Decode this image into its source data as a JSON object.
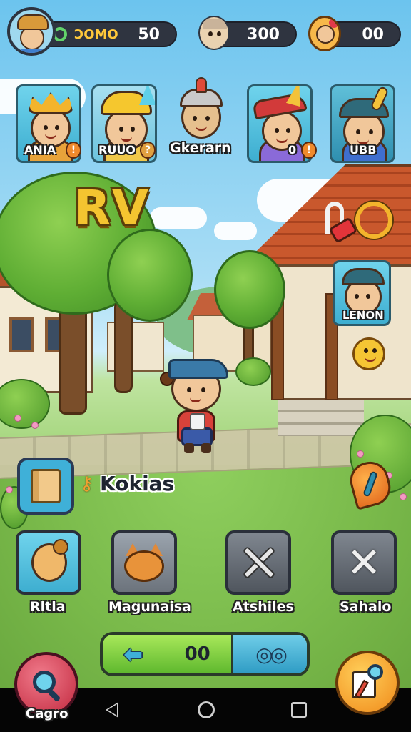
{
  "hud": {
    "player_name": "ƆOMO",
    "player_score": "50",
    "elder_score": "300",
    "girl_score": "00"
  },
  "character_cards": [
    {
      "label": "ANIA",
      "badge": "!"
    },
    {
      "label": "RUUO",
      "badge": "?"
    },
    {
      "label": "Gkerarn",
      "badge": ""
    },
    {
      "label": "0",
      "badge": "!"
    },
    {
      "label": "UBB",
      "badge": ""
    }
  ],
  "logo": "RV",
  "side": {
    "lenon_label": "LENON",
    "top_icon": "magnet-icon",
    "emoji_icon": "smile-icon",
    "feather_icon": "quill-icon"
  },
  "menu": {
    "kokias_label": "Kokias",
    "tiles": [
      {
        "label": "Rltla",
        "icon": "portrait-icon"
      },
      {
        "label": "Magunaisa",
        "icon": "cat-icon"
      },
      {
        "label": "Atshiles",
        "icon": "tools-icon"
      },
      {
        "label": "Sahalo",
        "icon": "close-icon"
      }
    ]
  },
  "controls": {
    "value": "00",
    "left_button": "back-arrow-icon",
    "right_button": "binoculars-icon"
  },
  "bottom": {
    "cagro_label": "Cagro"
  },
  "colors": {
    "sky": "#6cc4ee",
    "grass": "#7fbe50",
    "hud_pill": "#2f3440",
    "accent_gold": "#f4c430",
    "tile_blue": "#3fb0d8",
    "tile_gray": "#6c737c"
  }
}
